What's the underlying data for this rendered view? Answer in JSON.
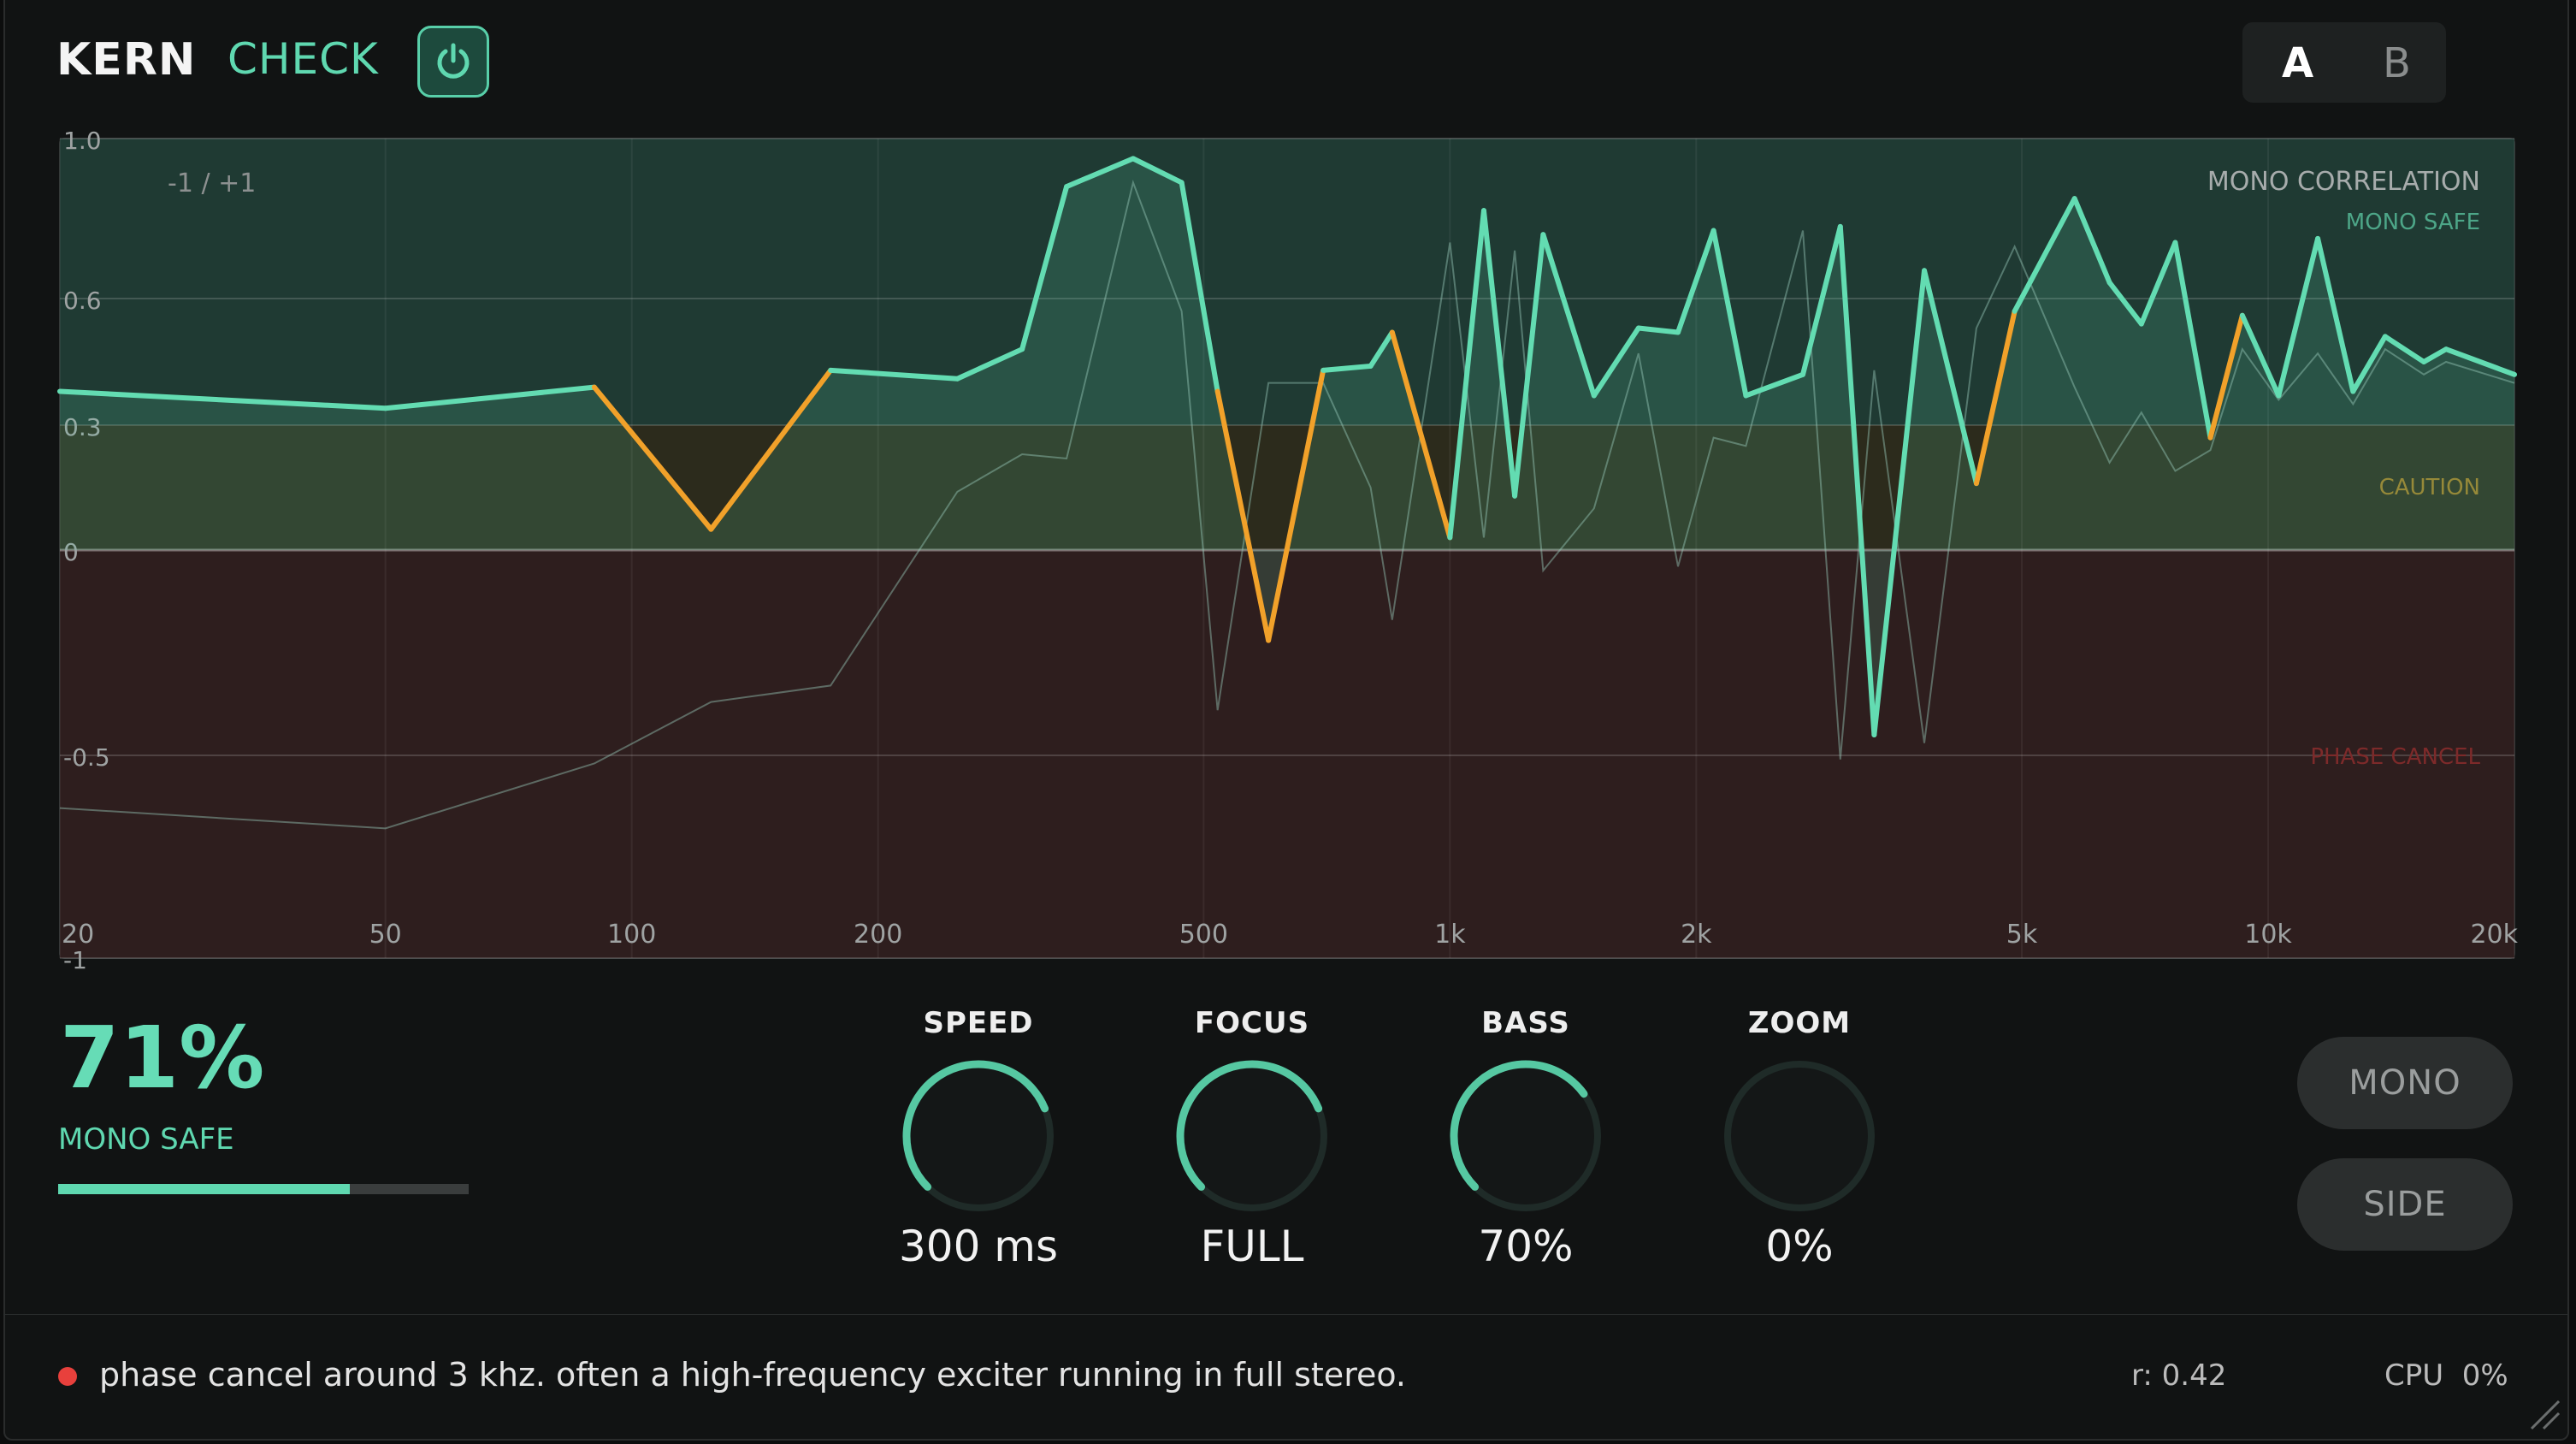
{
  "header": {
    "brand": "KERN",
    "product": "CHECK",
    "ab_a": "A",
    "ab_b": "B"
  },
  "chart_data": {
    "type": "line",
    "title": "MONO CORRELATION",
    "corner_label": "-1 / +1",
    "x_scale": "log",
    "xlim": [
      20,
      20000
    ],
    "ylim": [
      -1,
      1
    ],
    "y_ticks": [
      "1.0",
      "0.6",
      "0.3",
      "0",
      "-0.5",
      "-1"
    ],
    "x_ticks": [
      {
        "label": "20",
        "value": 20
      },
      {
        "label": "50",
        "value": 50
      },
      {
        "label": "100",
        "value": 100
      },
      {
        "label": "200",
        "value": 200
      },
      {
        "label": "500",
        "value": 500
      },
      {
        "label": "1k",
        "value": 1000
      },
      {
        "label": "2k",
        "value": 2000
      },
      {
        "label": "5k",
        "value": 5000
      },
      {
        "label": "10k",
        "value": 10000
      },
      {
        "label": "20k",
        "value": 20000
      }
    ],
    "zones": [
      {
        "name": "MONO SAFE",
        "from": 0.3,
        "to": 1.0,
        "color": "#1f3a33"
      },
      {
        "name": "CAUTION",
        "from": 0.0,
        "to": 0.3,
        "color": "#2c2b1c"
      },
      {
        "name": "PHASE CANCEL",
        "from": -1.0,
        "to": 0.0,
        "color": "#2e1e1e"
      }
    ],
    "colors": {
      "safe": "#63dcb2",
      "caution": "#f1a12a",
      "cancel_label": "#8a2b2b"
    },
    "series": [
      {
        "name": "correlation",
        "x": [
          20,
          50,
          90,
          125,
          175,
          250,
          300,
          340,
          410,
          470,
          520,
          600,
          700,
          800,
          850,
          1000,
          1100,
          1200,
          1300,
          1500,
          1700,
          1900,
          2100,
          2300,
          2700,
          3000,
          3300,
          3800,
          4400,
          4900,
          5800,
          6400,
          7000,
          7700,
          8500,
          9300,
          10300,
          11500,
          12700,
          13900,
          15500,
          16500,
          20000
        ],
        "y": [
          0.38,
          0.34,
          0.39,
          0.05,
          0.43,
          0.41,
          0.48,
          0.88,
          0.95,
          0.89,
          0.38,
          -0.22,
          0.43,
          0.44,
          0.52,
          0.03,
          0.82,
          0.13,
          0.76,
          0.37,
          0.53,
          0.52,
          0.77,
          0.37,
          0.42,
          0.78,
          -0.45,
          0.67,
          0.16,
          0.57,
          0.85,
          0.64,
          0.54,
          0.74,
          0.27,
          0.56,
          0.37,
          0.75,
          0.38,
          0.51,
          0.45,
          0.48,
          0.42
        ]
      },
      {
        "name": "reference",
        "x": [
          20,
          50,
          90,
          125,
          175,
          250,
          300,
          340,
          410,
          470,
          520,
          600,
          700,
          800,
          850,
          1000,
          1100,
          1200,
          1300,
          1500,
          1700,
          1900,
          2100,
          2300,
          2700,
          3000,
          3300,
          3800,
          4400,
          4900,
          5800,
          6400,
          7000,
          7700,
          8500,
          9300,
          10300,
          11500,
          12700,
          13900,
          15500,
          16500,
          20000
        ],
        "y": [
          -0.63,
          -0.68,
          -0.52,
          -0.37,
          -0.33,
          0.14,
          0.23,
          0.22,
          0.89,
          0.57,
          -0.39,
          0.4,
          0.4,
          0.15,
          -0.17,
          0.74,
          0.03,
          0.72,
          -0.05,
          0.1,
          0.47,
          -0.04,
          0.27,
          0.25,
          0.77,
          -0.51,
          0.43,
          -0.47,
          0.53,
          0.73,
          0.39,
          0.21,
          0.33,
          0.19,
          0.24,
          0.48,
          0.36,
          0.47,
          0.35,
          0.48,
          0.42,
          0.45,
          0.4
        ]
      }
    ]
  },
  "readout": {
    "percent": "71%",
    "label": "MONO SAFE",
    "level": 0.71
  },
  "knobs": [
    {
      "label": "SPEED",
      "value": "300 ms",
      "level": 0.75
    },
    {
      "label": "FOCUS",
      "value": "FULL",
      "level": 0.75
    },
    {
      "label": "BASS",
      "value": "70%",
      "level": 0.7
    },
    {
      "label": "ZOOM",
      "value": "0%",
      "level": 0.0
    }
  ],
  "buttons": {
    "mono": "MONO",
    "side": "SIDE"
  },
  "status": {
    "message": "phase cancel around 3 khz. often a high-frequency exciter running in full stereo.",
    "correlation": "r: 0.42",
    "cpu_label": "CPU",
    "cpu_value": "0%",
    "indicator_color": "#e8403c"
  }
}
